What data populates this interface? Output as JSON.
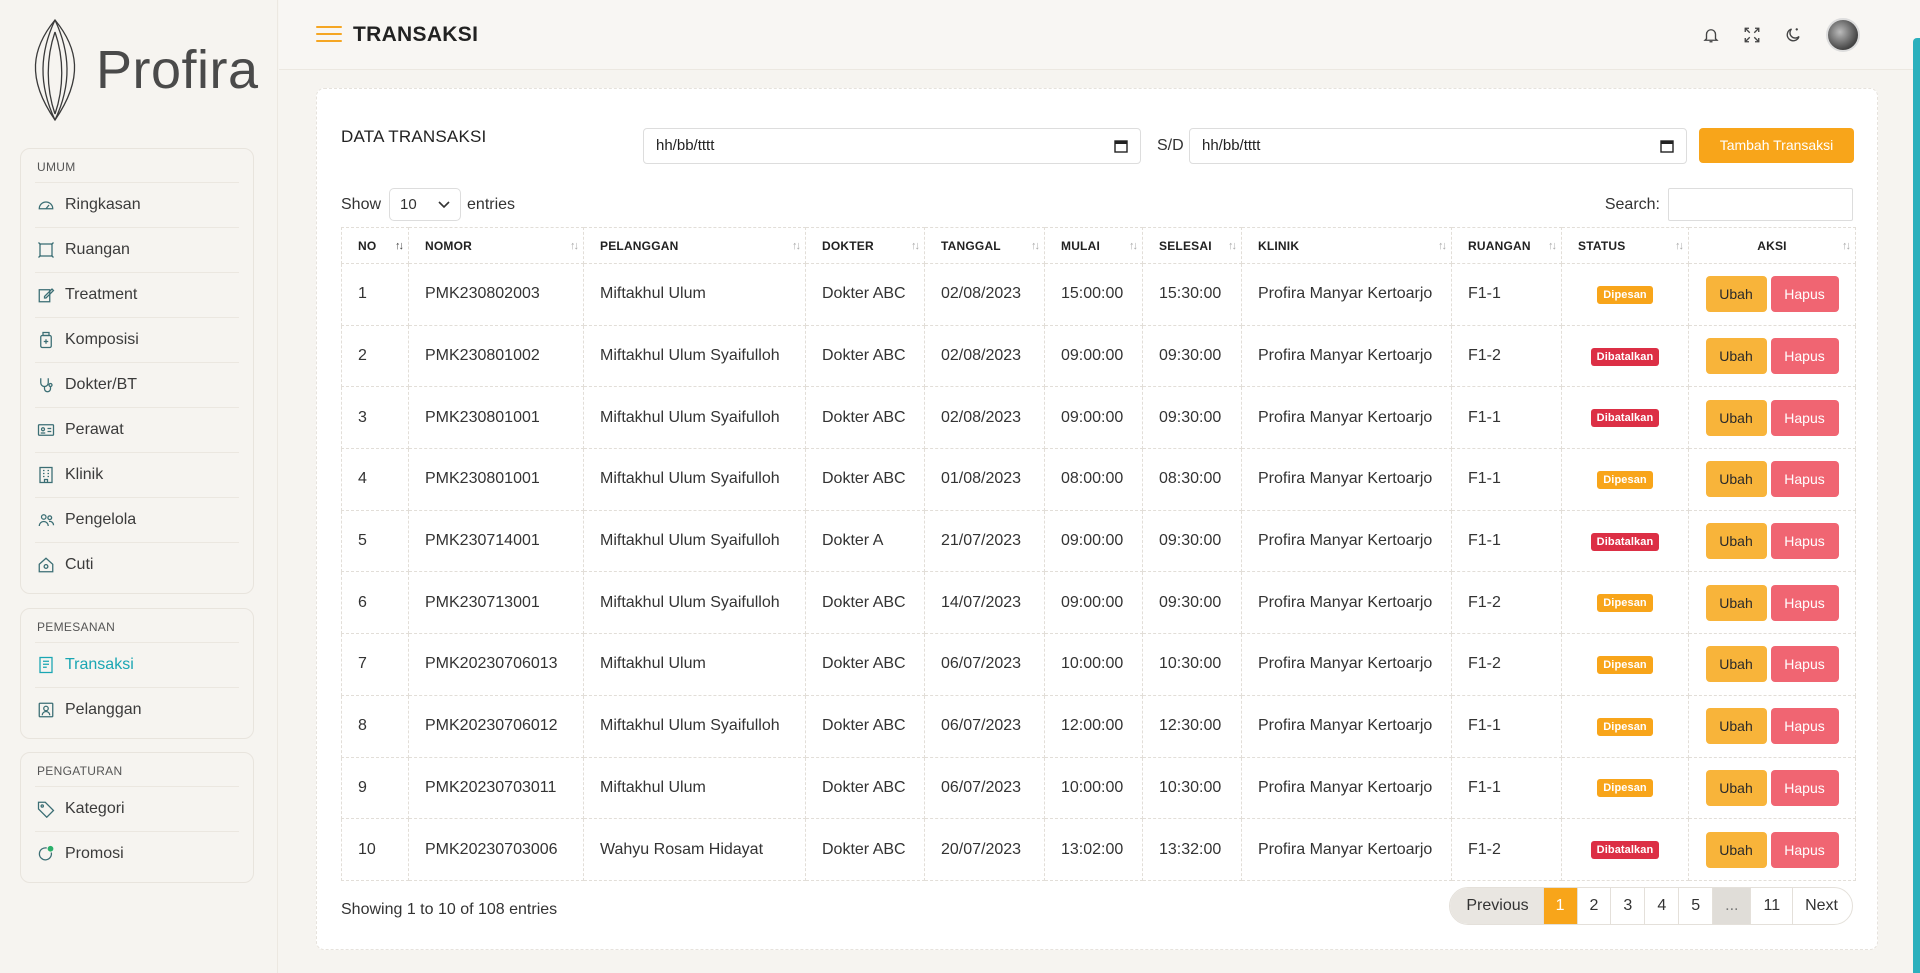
{
  "app": {
    "logo_text": "Profira",
    "page_title": "TRANSAKSI"
  },
  "sidebar": {
    "groups": [
      {
        "title": "UMUM",
        "items": [
          {
            "label": "Ringkasan",
            "icon": "dashboard-icon"
          },
          {
            "label": "Ruangan",
            "icon": "room-icon"
          },
          {
            "label": "Treatment",
            "icon": "edit-icon"
          },
          {
            "label": "Komposisi",
            "icon": "bottle-icon"
          },
          {
            "label": "Dokter/BT",
            "icon": "stethoscope-icon"
          },
          {
            "label": "Perawat",
            "icon": "id-card-icon"
          },
          {
            "label": "Klinik",
            "icon": "building-icon"
          },
          {
            "label": "Pengelola",
            "icon": "users-icon"
          },
          {
            "label": "Cuti",
            "icon": "home-icon"
          }
        ]
      },
      {
        "title": "PEMESANAN",
        "items": [
          {
            "label": "Transaksi",
            "icon": "receipt-icon",
            "active": true
          },
          {
            "label": "Pelanggan",
            "icon": "user-card-icon"
          }
        ]
      },
      {
        "title": "PENGATURAN",
        "items": [
          {
            "label": "Kategori",
            "icon": "tag-icon"
          },
          {
            "label": "Promosi",
            "icon": "promo-icon"
          }
        ]
      }
    ]
  },
  "header_icons": [
    "bell-icon",
    "fullscreen-icon",
    "moon-icon"
  ],
  "card": {
    "title": "DATA TRANSAKSI",
    "date_from_placeholder": "hh/bb/tttt",
    "date_to_placeholder": "hh/bb/tttt",
    "sd_label": "S/D",
    "add_button": "Tambah Transaksi",
    "show_label": "Show",
    "entries_value": "10",
    "entries_label": "entries",
    "search_label": "Search:"
  },
  "table": {
    "columns": [
      "NO",
      "NOMOR",
      "PELANGGAN",
      "DOKTER",
      "TANGGAL",
      "MULAI",
      "SELESAI",
      "KLINIK",
      "RUANGAN",
      "STATUS",
      "AKSI"
    ],
    "edit_label": "Ubah",
    "delete_label": "Hapus",
    "rows": [
      {
        "no": "1",
        "nomor": "PMK230802003",
        "pelanggan": "Miftakhul Ulum",
        "dokter": "Dokter ABC",
        "tanggal": "02/08/2023",
        "mulai": "15:00:00",
        "selesai": "15:30:00",
        "klinik": "Profira Manyar Kertoarjo",
        "ruangan": "F1-1",
        "status": "Dipesan"
      },
      {
        "no": "2",
        "nomor": "PMK230801002",
        "pelanggan": "Miftakhul Ulum Syaifulloh",
        "dokter": "Dokter ABC",
        "tanggal": "02/08/2023",
        "mulai": "09:00:00",
        "selesai": "09:30:00",
        "klinik": "Profira Manyar Kertoarjo",
        "ruangan": "F1-2",
        "status": "Dibatalkan"
      },
      {
        "no": "3",
        "nomor": "PMK230801001",
        "pelanggan": "Miftakhul Ulum Syaifulloh",
        "dokter": "Dokter ABC",
        "tanggal": "02/08/2023",
        "mulai": "09:00:00",
        "selesai": "09:30:00",
        "klinik": "Profira Manyar Kertoarjo",
        "ruangan": "F1-1",
        "status": "Dibatalkan"
      },
      {
        "no": "4",
        "nomor": "PMK230801001",
        "pelanggan": "Miftakhul Ulum Syaifulloh",
        "dokter": "Dokter ABC",
        "tanggal": "01/08/2023",
        "mulai": "08:00:00",
        "selesai": "08:30:00",
        "klinik": "Profira Manyar Kertoarjo",
        "ruangan": "F1-1",
        "status": "Dipesan"
      },
      {
        "no": "5",
        "nomor": "PMK230714001",
        "pelanggan": "Miftakhul Ulum Syaifulloh",
        "dokter": "Dokter A",
        "tanggal": "21/07/2023",
        "mulai": "09:00:00",
        "selesai": "09:30:00",
        "klinik": "Profira Manyar Kertoarjo",
        "ruangan": "F1-1",
        "status": "Dibatalkan"
      },
      {
        "no": "6",
        "nomor": "PMK230713001",
        "pelanggan": "Miftakhul Ulum Syaifulloh",
        "dokter": "Dokter ABC",
        "tanggal": "14/07/2023",
        "mulai": "09:00:00",
        "selesai": "09:30:00",
        "klinik": "Profira Manyar Kertoarjo",
        "ruangan": "F1-2",
        "status": "Dipesan"
      },
      {
        "no": "7",
        "nomor": "PMK20230706013",
        "pelanggan": "Miftakhul Ulum",
        "dokter": "Dokter ABC",
        "tanggal": "06/07/2023",
        "mulai": "10:00:00",
        "selesai": "10:30:00",
        "klinik": "Profira Manyar Kertoarjo",
        "ruangan": "F1-2",
        "status": "Dipesan"
      },
      {
        "no": "8",
        "nomor": "PMK20230706012",
        "pelanggan": "Miftakhul Ulum Syaifulloh",
        "dokter": "Dokter ABC",
        "tanggal": "06/07/2023",
        "mulai": "12:00:00",
        "selesai": "12:30:00",
        "klinik": "Profira Manyar Kertoarjo",
        "ruangan": "F1-1",
        "status": "Dipesan"
      },
      {
        "no": "9",
        "nomor": "PMK20230703011",
        "pelanggan": "Miftakhul Ulum",
        "dokter": "Dokter ABC",
        "tanggal": "06/07/2023",
        "mulai": "10:00:00",
        "selesai": "10:30:00",
        "klinik": "Profira Manyar Kertoarjo",
        "ruangan": "F1-1",
        "status": "Dipesan"
      },
      {
        "no": "10",
        "nomor": "PMK20230703006",
        "pelanggan": "Wahyu Rosam Hidayat",
        "dokter": "Dokter ABC",
        "tanggal": "20/07/2023",
        "mulai": "13:02:00",
        "selesai": "13:32:00",
        "klinik": "Profira Manyar Kertoarjo",
        "ruangan": "F1-2",
        "status": "Dibatalkan"
      }
    ]
  },
  "footer": {
    "info": "Showing 1 to 10 of 108 entries",
    "pagination": [
      "Previous",
      "1",
      "2",
      "3",
      "4",
      "5",
      "...",
      "11",
      "Next"
    ],
    "active_page": "1"
  },
  "colors": {
    "accent": "#f8a51a",
    "active_nav": "#1aa6b3",
    "danger": "#dc2f45"
  }
}
